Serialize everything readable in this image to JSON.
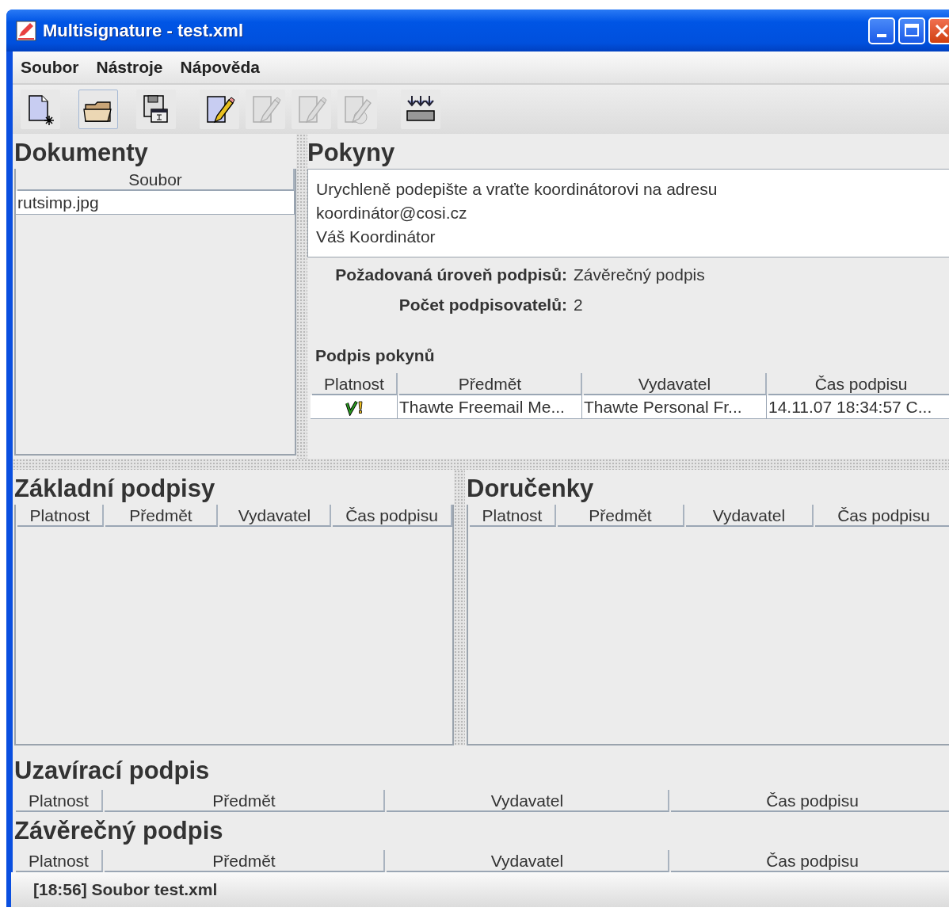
{
  "window": {
    "title": "Multisignature - test.xml"
  },
  "menu": [
    {
      "label": "Soubor"
    },
    {
      "label": "Nástroje"
    },
    {
      "label": "Nápověda"
    }
  ],
  "toolbar": [
    {
      "kind": "new",
      "disabled": false,
      "selected": false
    },
    {
      "kind": "open",
      "disabled": false,
      "selected": true
    },
    {
      "kind": "save",
      "disabled": false,
      "selected": false
    },
    {
      "kind": "sign",
      "disabled": false,
      "selected": false
    },
    {
      "kind": "sign",
      "disabled": true,
      "selected": false
    },
    {
      "kind": "sign",
      "disabled": true,
      "selected": false
    },
    {
      "kind": "sign_globe",
      "disabled": true,
      "selected": false
    },
    {
      "kind": "import",
      "disabled": false,
      "selected": false
    }
  ],
  "documents": {
    "title": "Dokumenty",
    "columns": [
      "Soubor"
    ],
    "rows": [
      "rutsimp.jpg"
    ]
  },
  "instructions": {
    "title": "Pokyny",
    "text": [
      "Urychleně podepište a vraťte koordinátorovi na adresu",
      "koordinátor@cosi.cz",
      "Váš Koordinátor"
    ],
    "fields": [
      {
        "label": "Požadovaná úroveň podpisů:",
        "value": "Závěrečný podpis"
      },
      {
        "label": "Počet podpisovatelů:",
        "value": "2"
      }
    ],
    "signature_title": "Podpis pokynů",
    "columns": [
      "Platnost",
      "Předmět",
      "Vydavatel",
      "Čas podpisu"
    ],
    "rows": [
      {
        "kind": "valid_warning",
        "cells": [
          "",
          "Thawte Freemail Me...",
          "Thawte Personal Fr...",
          "14.11.07 18:34:57 C..."
        ]
      }
    ]
  },
  "basic_signatures": {
    "title": "Základní podpisy",
    "columns": [
      "Platnost",
      "Předmět",
      "Vydavatel",
      "Čas podpisu"
    ]
  },
  "receipts": {
    "title": "Doručenky",
    "columns": [
      "Platnost",
      "Předmět",
      "Vydavatel",
      "Čas podpisu"
    ]
  },
  "closing_signature": {
    "title": "Uzavírací podpis",
    "columns": [
      "Platnost",
      "Předmět",
      "Vydavatel",
      "Čas podpisu"
    ]
  },
  "final_signature": {
    "title": "Závěrečný podpis",
    "columns": [
      "Platnost",
      "Předmět",
      "Vydavatel",
      "Čas podpisu"
    ]
  },
  "status_bar": {
    "text": "[18:56] Soubor test.xml"
  }
}
